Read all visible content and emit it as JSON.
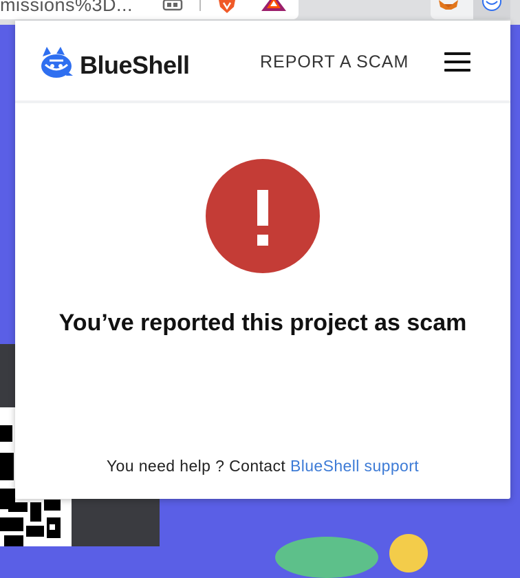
{
  "browser": {
    "url_fragment": "missions%3D...",
    "extensions": [
      "reader-mode-icon",
      "brave-icon",
      "bat-icon",
      "metamask-icon",
      "blueshell-icon"
    ]
  },
  "popup": {
    "brand": "BlueShell",
    "nav": {
      "report_link": "REPORT A SCAM",
      "menu_icon": "hamburger-icon"
    },
    "status": {
      "icon": "alert-exclamation-icon",
      "message": "You’ve reported this project as scam"
    },
    "footer": {
      "help_text": "You need help ? Contact ",
      "support_link": "BlueShell support"
    }
  },
  "colors": {
    "brand_blue": "#2f6ff0",
    "alert_red": "#c43c36",
    "link_blue": "#3d7bd6",
    "page_bg": "#5a5fe6"
  }
}
